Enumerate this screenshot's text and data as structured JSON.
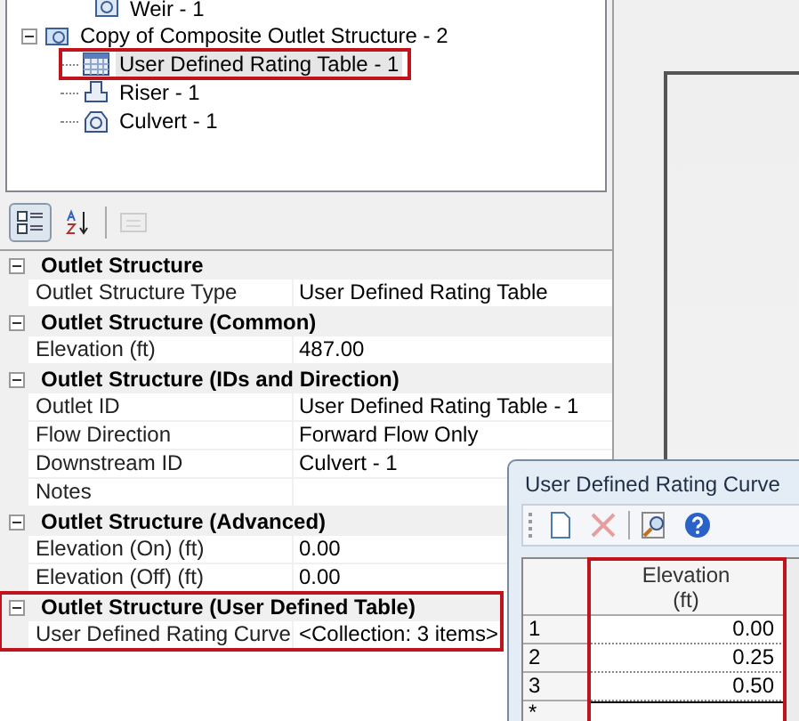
{
  "tree": [
    {
      "label": "Weir - 1",
      "kind": "weir",
      "selected": false,
      "highlighted": false
    },
    {
      "label": "Copy of Composite Outlet Structure - 2",
      "kind": "composite",
      "expanded": true,
      "selected": false,
      "highlighted": false,
      "children": [
        {
          "label": "User Defined Rating Table - 1",
          "kind": "table",
          "selected": true,
          "highlighted": true
        },
        {
          "label": "Riser - 1",
          "kind": "riser",
          "selected": false,
          "highlighted": false
        },
        {
          "label": "Culvert - 1",
          "kind": "culvert",
          "selected": false,
          "highlighted": false
        }
      ]
    }
  ],
  "toolbar": [
    {
      "kind": "categorized",
      "selected": true,
      "disabled": false
    },
    {
      "kind": "alphabetical",
      "selected": false,
      "disabled": false
    },
    {
      "kind": "pages",
      "selected": false,
      "disabled": true
    }
  ],
  "properties": [
    {
      "category": "Outlet Structure",
      "expanded": true,
      "highlighted": false,
      "rows": [
        {
          "label": "Outlet Structure Type",
          "value": "User Defined Rating Table"
        }
      ]
    },
    {
      "category": "Outlet Structure (Common)",
      "expanded": true,
      "highlighted": false,
      "rows": [
        {
          "label": "Elevation (ft)",
          "value": "487.00"
        }
      ]
    },
    {
      "category": "Outlet Structure (IDs and Direction)",
      "expanded": true,
      "highlighted": false,
      "rows": [
        {
          "label": "Outlet ID",
          "value": "User Defined Rating Table - 1"
        },
        {
          "label": "Flow Direction",
          "value": "Forward Flow Only"
        },
        {
          "label": "Downstream ID",
          "value": "Culvert - 1"
        },
        {
          "label": "Notes",
          "value": ""
        }
      ]
    },
    {
      "category": "Outlet Structure (Advanced)",
      "expanded": true,
      "highlighted": false,
      "rows": [
        {
          "label": "Elevation (On) (ft)",
          "value": "0.00"
        },
        {
          "label": "Elevation (Off) (ft)",
          "value": "0.00"
        }
      ]
    },
    {
      "category": "Outlet Structure (User Defined Table)",
      "expanded": true,
      "highlighted": true,
      "rows": [
        {
          "label": "User Defined Rating Curve",
          "value": "<Collection: 3 items>"
        }
      ]
    }
  ],
  "dialog": {
    "title": "User Defined Rating Curve",
    "tools": [
      {
        "kind": "new",
        "disabled": false
      },
      {
        "kind": "delete",
        "disabled": true
      },
      {
        "kind": "find",
        "disabled": false
      },
      {
        "kind": "help",
        "disabled": false
      }
    ],
    "columns": [
      {
        "title": "Elevation",
        "unit": "(ft)",
        "highlighted": true
      }
    ],
    "rows": [
      {
        "num": "1",
        "values": [
          "0.00"
        ]
      },
      {
        "num": "2",
        "values": [
          "0.25"
        ]
      },
      {
        "num": "3",
        "values": [
          "0.50"
        ]
      }
    ],
    "new_row_marker": "*"
  }
}
